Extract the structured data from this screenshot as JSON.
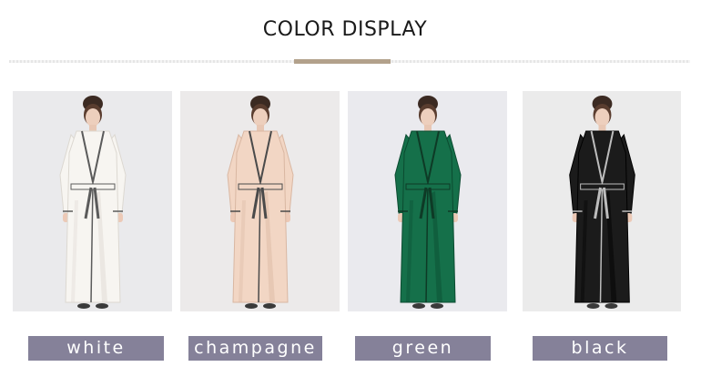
{
  "header": {
    "title": "COLOR DISPLAY"
  },
  "colors": [
    {
      "label": "white",
      "robe": "#f7f5f1",
      "shade": "#dcd8d1",
      "trim": "#5b5b5b",
      "bg": "#eaeaec"
    },
    {
      "label": "champagne",
      "robe": "#f2d6c4",
      "shade": "#d9b7a2",
      "trim": "#4a4a4a",
      "bg": "#eceaea"
    },
    {
      "label": "green",
      "robe": "#15704a",
      "shade": "#0b4b30",
      "trim": "#0e3a26",
      "bg": "#eaeaee"
    },
    {
      "label": "black",
      "robe": "#1b1b1b",
      "shade": "#000000",
      "trim": "#bdbdbd",
      "bg": "#ebebeb"
    }
  ]
}
